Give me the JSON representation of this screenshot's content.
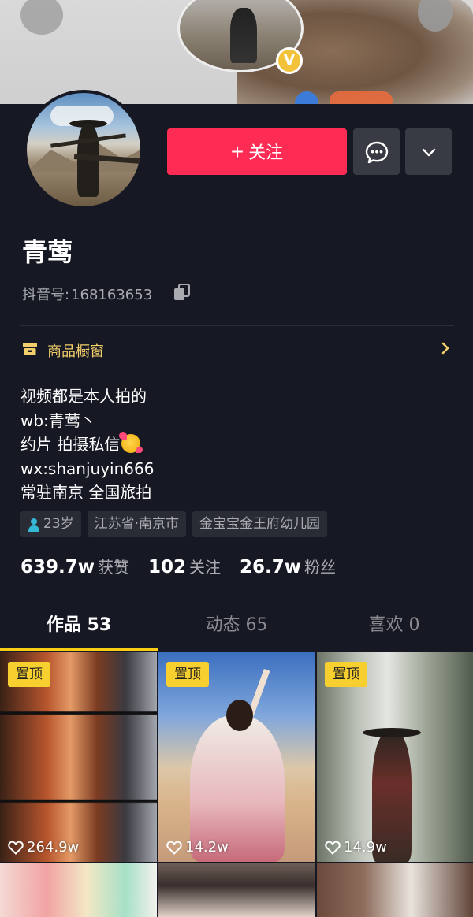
{
  "profile": {
    "name": "青莺",
    "douyin_id_label": "抖音号:",
    "douyin_id": "168163653",
    "verified_badge": "V"
  },
  "actions": {
    "follow_icon": "+",
    "follow_label": "关注",
    "message_icon": "chat-bubble-icon",
    "more_icon": "chevron-down-icon"
  },
  "shop": {
    "label": "商品橱窗",
    "icon": "shop-window-icon"
  },
  "bio": {
    "line1": "视频都是本人拍的",
    "line2": "wb:青莺丶",
    "line3": "约片 拍摄私信",
    "line4": "wx:shanjuyin666",
    "line5": "常驻南京 全国旅拍"
  },
  "tags": {
    "age": "23岁",
    "location": "江苏省·南京市",
    "school": "金宝宝金王府幼儿园"
  },
  "stats": {
    "likes_value": "639.7w",
    "likes_label": "获赞",
    "following_value": "102",
    "following_label": "关注",
    "fans_value": "26.7w",
    "fans_label": "粉丝"
  },
  "tabs": [
    {
      "label": "作品 53",
      "active": true
    },
    {
      "label": "动态 65",
      "active": false
    },
    {
      "label": "喜欢 0",
      "active": false
    }
  ],
  "videos": [
    {
      "pinned_label": "置顶",
      "likes": "264.9w"
    },
    {
      "pinned_label": "置顶",
      "likes": "14.2w"
    },
    {
      "pinned_label": "置顶",
      "likes": "14.9w"
    }
  ],
  "colors": {
    "background": "#161823",
    "follow_button": "#fe2c55",
    "accent_yellow": "#face15",
    "shop_text": "#f2cf6b"
  }
}
